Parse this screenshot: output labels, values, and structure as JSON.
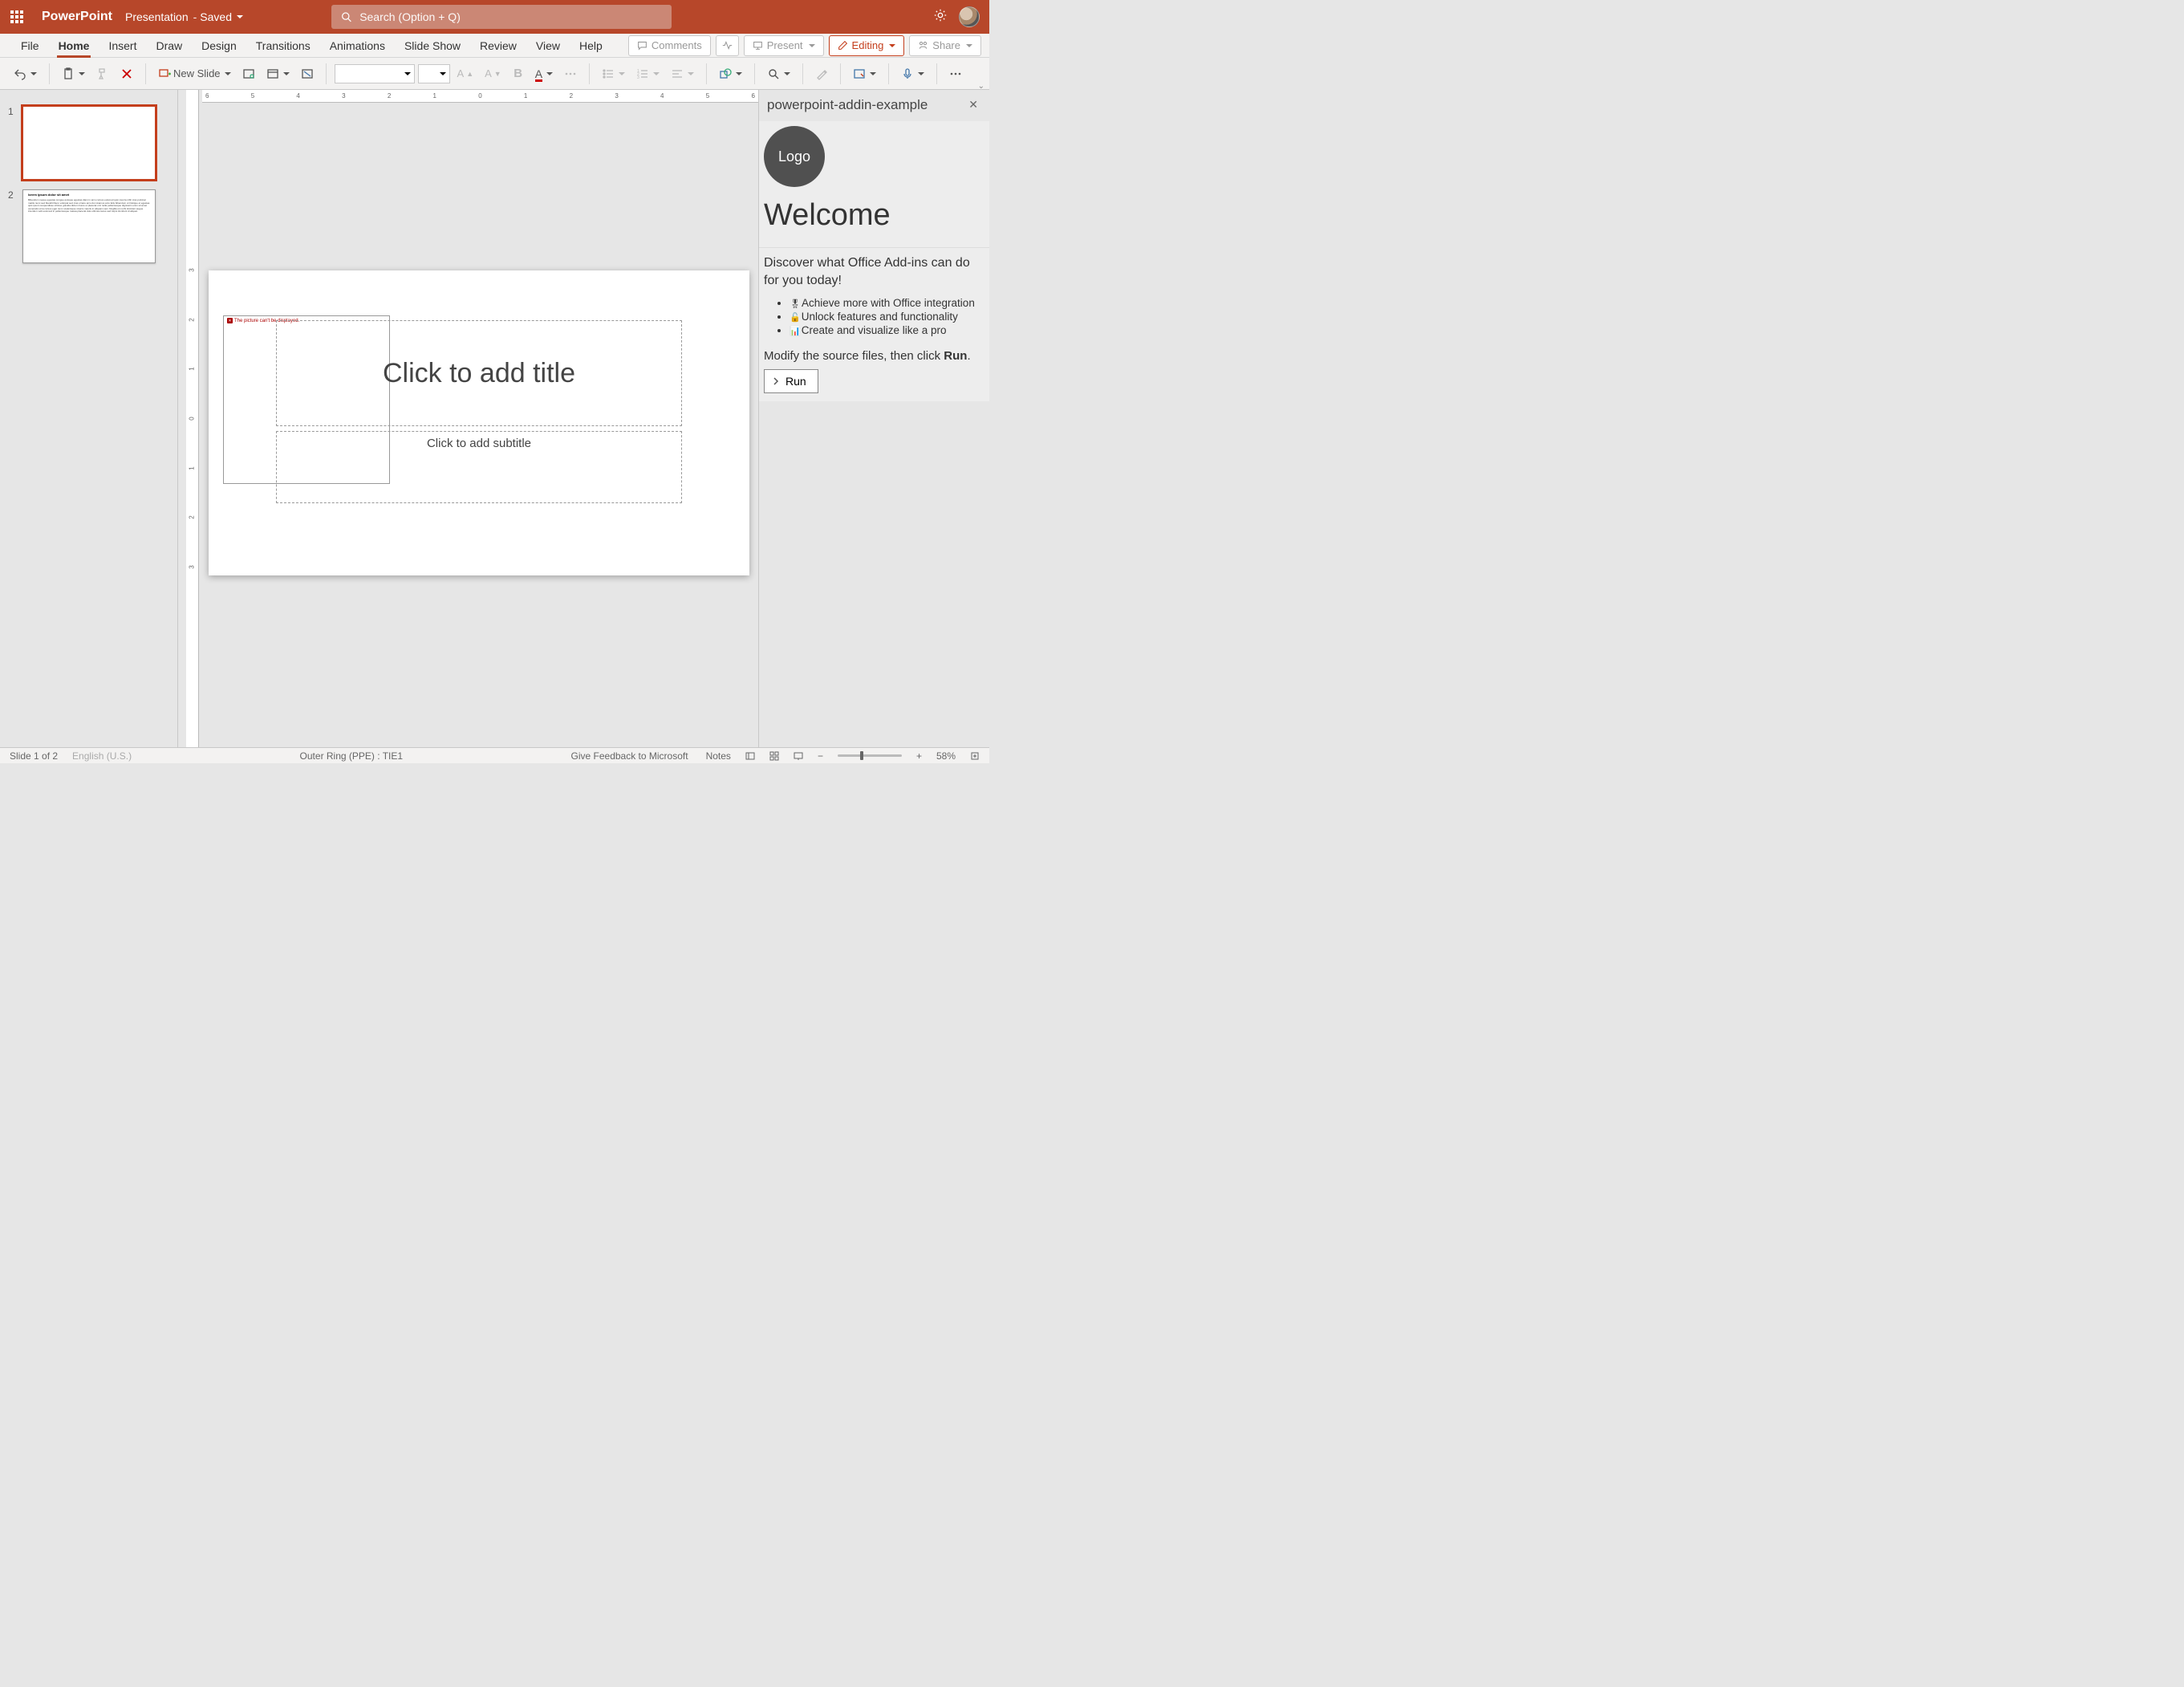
{
  "titlebar": {
    "app_name": "PowerPoint",
    "doc_name": "Presentation",
    "status": "Saved",
    "search_placeholder": "Search (Option + Q)"
  },
  "tabs": {
    "file": "File",
    "home": "Home",
    "insert": "Insert",
    "draw": "Draw",
    "design": "Design",
    "transitions": "Transitions",
    "animations": "Animations",
    "slideshow": "Slide Show",
    "review": "Review",
    "view": "View",
    "help": "Help"
  },
  "tabright": {
    "comments": "Comments",
    "present": "Present",
    "editing": "Editing",
    "share": "Share"
  },
  "ribbon": {
    "new_slide": "New Slide",
    "bold": "B"
  },
  "ruler": {
    "h": [
      "6",
      "5",
      "4",
      "3",
      "2",
      "1",
      "0",
      "1",
      "2",
      "3",
      "4",
      "5",
      "6"
    ],
    "v": [
      "3",
      "2",
      "1",
      "0",
      "1",
      "2",
      "3"
    ]
  },
  "thumbs": {
    "n1": "1",
    "n2": "2",
    "slide2_title": "lorem ipsum dolor sit amet",
    "slide2_body": "Bibendum neque egestas congue quisque egestas diam in arcu cursus euismod quis viverra nibh cras pulvinar mattis nunc sed blandit libero volutpat sed cras ornare arcu dui vivamus arcu felis bibendum ut tristique et egestas quis ipsum suspendisse ultrices gravida dictum fusce ut placerat orci nulla pellentesque dignissim enim sit amet venenatis urna cursus eget nunc scelerisque viverra mauris in aliquam sem fringilla ut morbi tincidunt augue interdum velit euismod in pellentesque massa placerat duis ultricies lacus sed turpis tincidunt id aliquet."
  },
  "slide": {
    "img_error": "The picture can't be displayed.",
    "title_ph": "Click to add title",
    "sub_ph": "Click to add subtitle"
  },
  "pane": {
    "title": "powerpoint-addin-example",
    "logo": "Logo",
    "welcome": "Welcome",
    "desc": "Discover what Office Add-ins can do for you today!",
    "item1": "Achieve more with Office integration",
    "item2": "Unlock features and functionality",
    "item3": "Create and visualize like a pro",
    "modify_pre": "Modify the source files, then click ",
    "run_bold": "Run",
    "modify_post": ".",
    "run_btn": "Run"
  },
  "status": {
    "slide": "Slide 1 of 2",
    "lang": "English (U.S.)",
    "ring": "Outer Ring (PPE) : TIE1",
    "feedback": "Give Feedback to Microsoft",
    "notes": "Notes",
    "zoom_pct": "58%"
  }
}
